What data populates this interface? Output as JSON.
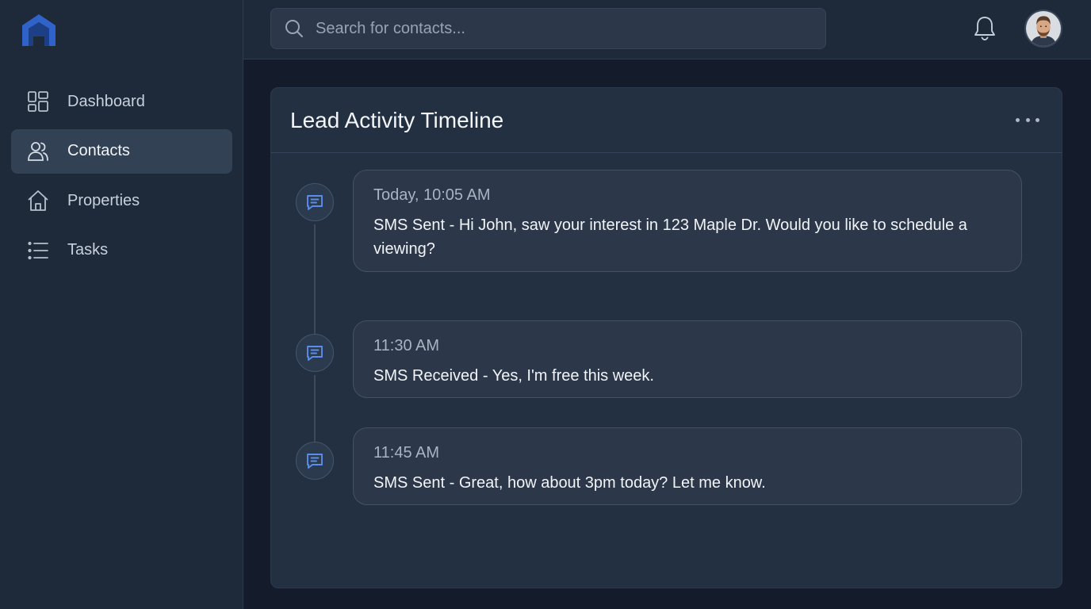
{
  "app": {
    "logo_icon": "house-logo-icon",
    "accent_color": "#3b6fd6"
  },
  "sidebar": {
    "items": [
      {
        "label": "Dashboard",
        "icon": "dashboard-grid-icon",
        "active": false
      },
      {
        "label": "Contacts",
        "icon": "users-icon",
        "active": true
      },
      {
        "label": "Properties",
        "icon": "home-icon",
        "active": false
      },
      {
        "label": "Tasks",
        "icon": "list-icon",
        "active": false
      }
    ]
  },
  "header": {
    "search": {
      "placeholder": "Search for contacts...",
      "value": ""
    },
    "notification_icon": "bell-icon",
    "avatar_icon": "user-avatar"
  },
  "card": {
    "title": "Lead Activity Timeline",
    "menu_icon": "more-horizontal-icon",
    "events": [
      {
        "time": "Today, 10:05 AM",
        "text": "SMS Sent - Hi John, saw your interest in 123 Maple Dr. Would you like to schedule a viewing?",
        "icon": "message-icon"
      },
      {
        "time": "11:30 AM",
        "text": "SMS Received - Yes, I'm free this week.",
        "icon": "message-icon"
      },
      {
        "time": "11:45 AM",
        "text": "SMS Sent - Great, how about 3pm today? Let me know.",
        "icon": "message-icon"
      }
    ]
  }
}
